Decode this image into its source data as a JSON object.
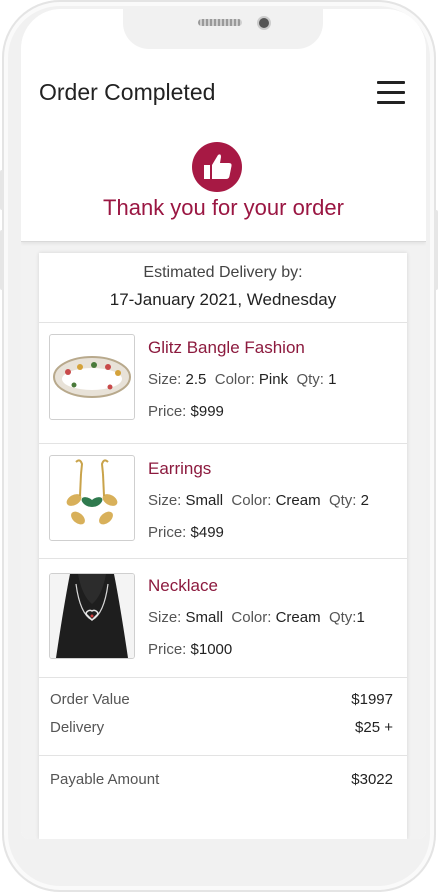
{
  "header": {
    "title": "Order Completed",
    "menu_icon": "hamburger-menu-icon"
  },
  "confirmation": {
    "icon": "thumbs-up-icon",
    "message": "Thank you for your order",
    "accent_color": "#9a1642"
  },
  "delivery": {
    "label": "Estimated Delivery by:",
    "date": "17-January 2021, Wednesday"
  },
  "items": [
    {
      "name": "Glitz Bangle Fashion",
      "size_label": "Size:",
      "size": "2.5",
      "color_label": "Color:",
      "color": "Pink",
      "qty_label": "Qty:",
      "qty": "1",
      "price_label": "Price:",
      "price": "$999"
    },
    {
      "name": "Earrings",
      "size_label": "Size:",
      "size": "Small",
      "color_label": "Color:",
      "color": "Cream",
      "qty_label": "Qty:",
      "qty": "2",
      "price_label": "Price:",
      "price": "$499"
    },
    {
      "name": "Necklace",
      "size_label": "Size:",
      "size": "Small",
      "color_label": "Color:",
      "color": "Cream",
      "qty_label": "Qty:",
      "qty": "1",
      "price_label": "Price:",
      "price": "$1000"
    }
  ],
  "summary": {
    "order_value_label": "Order Value",
    "order_value": "$1997",
    "delivery_label": "Delivery",
    "delivery": "$25 +",
    "payable_label": "Payable Amount",
    "payable": "$3022"
  }
}
